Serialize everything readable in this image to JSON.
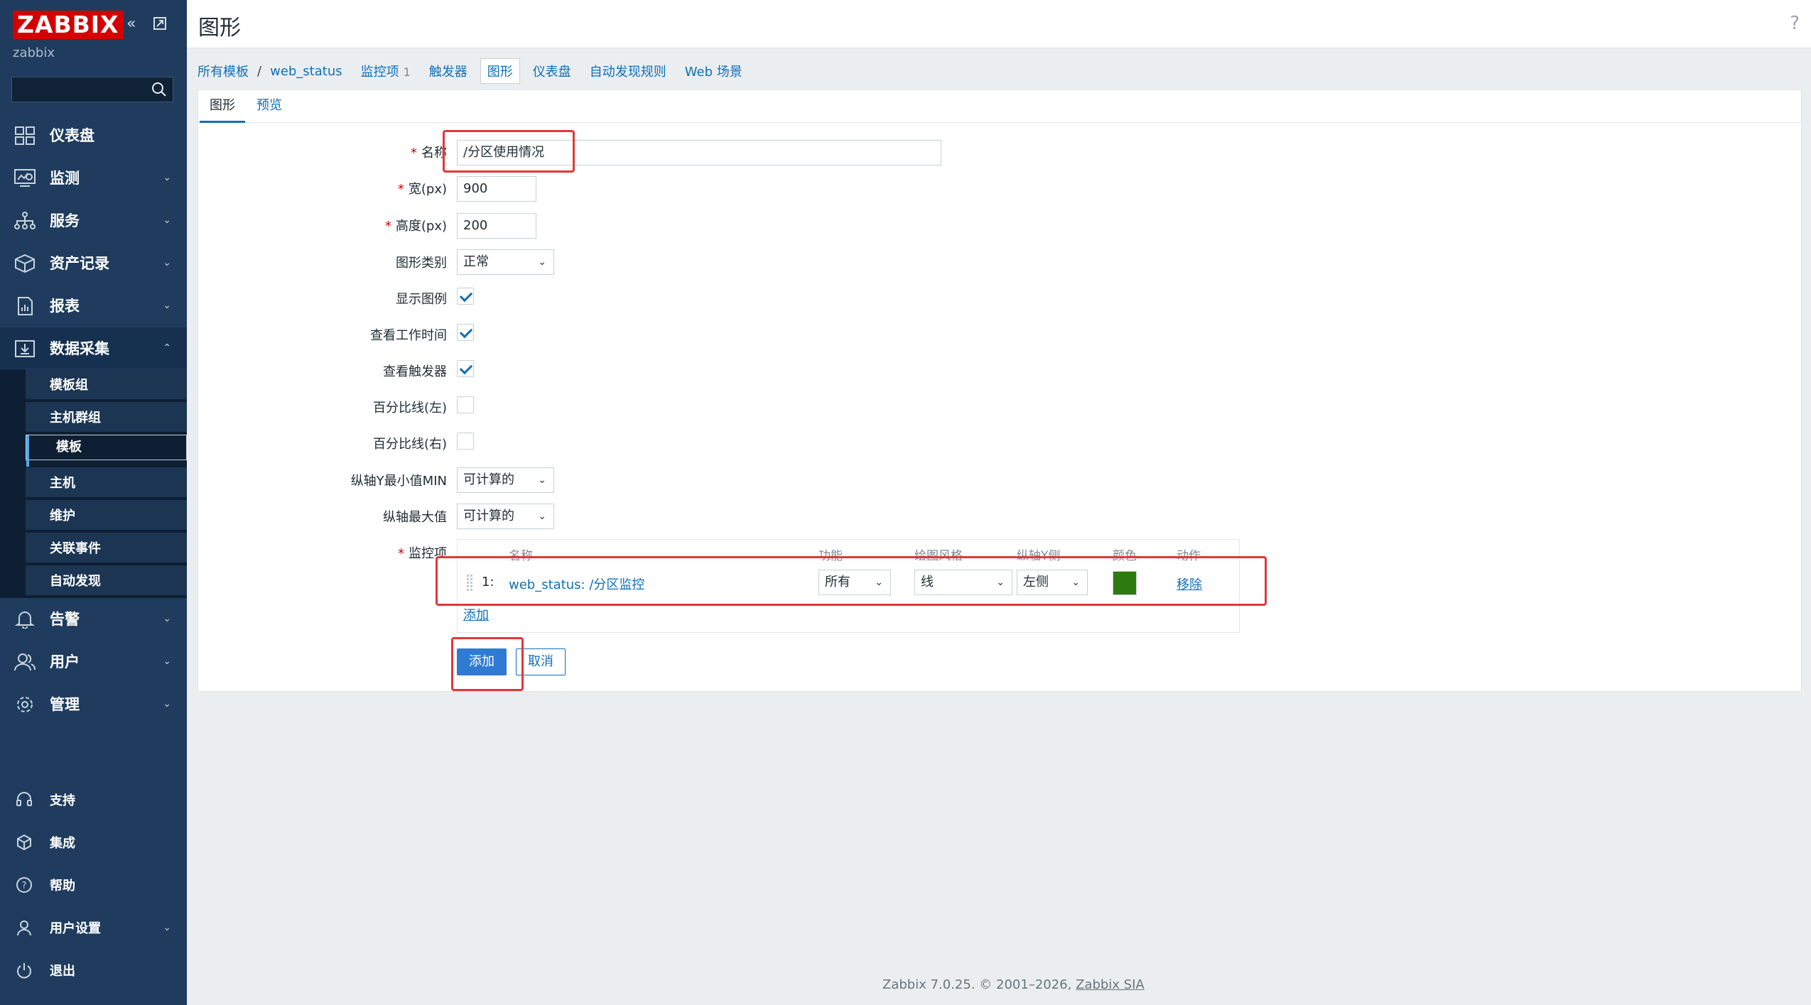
{
  "brand": {
    "logo": "ZABBIX",
    "subtitle": "zabbix"
  },
  "sidebar": {
    "menu": [
      {
        "label": "仪表盘"
      },
      {
        "label": "监测"
      },
      {
        "label": "服务"
      },
      {
        "label": "资产记录"
      },
      {
        "label": "报表"
      },
      {
        "label": "数据采集"
      }
    ],
    "submenu": [
      {
        "label": "模板组"
      },
      {
        "label": "主机群组"
      },
      {
        "label": "模板"
      },
      {
        "label": "主机"
      },
      {
        "label": "维护"
      },
      {
        "label": "关联事件"
      },
      {
        "label": "自动发现"
      }
    ],
    "menu2": [
      {
        "label": "告警"
      },
      {
        "label": "用户"
      },
      {
        "label": "管理"
      }
    ],
    "bottom": [
      {
        "label": "支持"
      },
      {
        "label": "集成"
      },
      {
        "label": "帮助"
      },
      {
        "label": "用户设置"
      },
      {
        "label": "退出"
      }
    ]
  },
  "header": {
    "title": "图形",
    "help": "?"
  },
  "breadcrumb": {
    "all_templates": "所有模板",
    "sep": "/",
    "template": "web_status",
    "items": "监控项",
    "items_count": "1",
    "triggers": "触发器",
    "graphs": "图形",
    "dashboards": "仪表盘",
    "discovery": "自动发现规则",
    "web": "Web 场景"
  },
  "tabs": {
    "graph": "图形",
    "preview": "预览"
  },
  "form": {
    "name_label": "名称",
    "name_value": "/分区使用情况",
    "width_label": "宽(px)",
    "width_value": "900",
    "height_label": "高度(px)",
    "height_value": "200",
    "graph_type_label": "图形类别",
    "graph_type_value": "正常",
    "show_legend_label": "显示图例",
    "show_worktime_label": "查看工作时间",
    "show_triggers_label": "查看触发器",
    "percent_left_label": "百分比线(左)",
    "percent_right_label": "百分比线(右)",
    "ymin_label": "纵轴Y最小值MIN",
    "ymin_value": "可计算的",
    "ymax_label": "纵轴最大值",
    "ymax_value": "可计算的",
    "items_label": "监控项",
    "items_headers": {
      "name": "名称",
      "function": "功能",
      "style": "绘图风格",
      "yaxis": "纵轴Y侧",
      "color": "颜色",
      "action": "动作"
    },
    "items": [
      {
        "index": "1:",
        "name": "web_status: /分区监控",
        "function": "所有",
        "style": "线",
        "yaxis": "左侧",
        "color": "#2d7a0f",
        "action": "移除"
      }
    ],
    "add_item": "添加",
    "add_button": "添加",
    "cancel_button": "取消"
  },
  "footer": {
    "text": "Zabbix 7.0.25. © 2001–2026,",
    "company": "Zabbix SIA"
  }
}
